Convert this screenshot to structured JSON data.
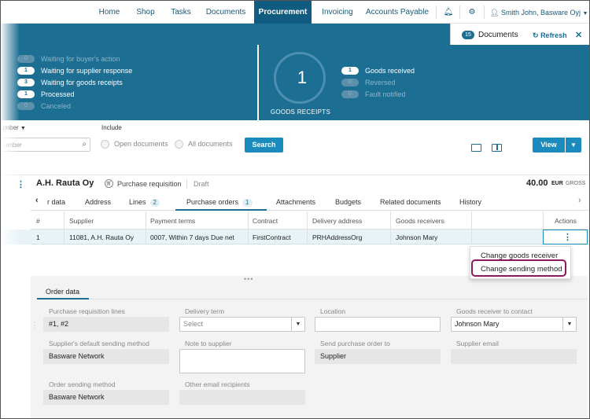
{
  "nav": {
    "items": [
      "Home",
      "Shop",
      "Tasks",
      "Documents",
      "Procurement",
      "Invoicing",
      "Accounts Payable"
    ],
    "user": "Smith John, Basware Oyj"
  },
  "doc_panel": {
    "count": "15",
    "label": "Documents",
    "refresh": "Refresh"
  },
  "dashboard_left": [
    {
      "count": "0",
      "label": "Waiting for buyer's action",
      "active": false
    },
    {
      "count": "1",
      "label": "Waiting for supplier response",
      "active": true
    },
    {
      "count": "3",
      "label": "Waiting for goods receipts",
      "active": true
    },
    {
      "count": "1",
      "label": "Processed",
      "active": true
    },
    {
      "count": "0",
      "label": "Canceled",
      "active": false
    }
  ],
  "dashboard_right": {
    "gauge_value": "1",
    "gauge_label": "GOODS RECEIPTS",
    "statuses": [
      {
        "count": "1",
        "label": "Goods received",
        "active": true
      },
      {
        "count": "0",
        "label": "Reversed",
        "active": false
      },
      {
        "count": "0",
        "label": "Fault notified",
        "active": false
      }
    ]
  },
  "search": {
    "sort_label": "umber",
    "include_label": "Include",
    "placeholder": "umber",
    "open_docs": "Open documents",
    "all_docs": "All documents",
    "search_button": "Search",
    "view_button": "View"
  },
  "document": {
    "supplier": "A.H. Rauta Oy",
    "type": "Purchase requisition",
    "status": "Draft",
    "total": "40.00",
    "currency": "EUR",
    "gross": "GROSS"
  },
  "tabs": [
    {
      "label": "r data",
      "count": ""
    },
    {
      "label": "Address",
      "count": ""
    },
    {
      "label": "Lines",
      "count": "2"
    },
    {
      "label": "Purchase orders",
      "count": "1"
    },
    {
      "label": "Attachments",
      "count": ""
    },
    {
      "label": "Budgets",
      "count": ""
    },
    {
      "label": "Related documents",
      "count": ""
    },
    {
      "label": "History",
      "count": ""
    }
  ],
  "table": {
    "headers": [
      "#",
      "Supplier",
      "Payment terms",
      "Contract",
      "Delivery address",
      "Goods receivers",
      "Actions"
    ],
    "rows": [
      [
        "1",
        "11081, A.H. Rauta Oy",
        "0007, Within 7 days Due net",
        "FirstContract",
        "PRHAddressOrg",
        "Johnson Mary"
      ]
    ]
  },
  "menu": {
    "items": [
      "Change goods receiver",
      "Change sending method"
    ]
  },
  "order_data": {
    "tab": "Order data",
    "fields": {
      "pr_lines_label": "Purchase requisition lines",
      "pr_lines_value": "#1, #2",
      "delivery_term_label": "Delivery term",
      "delivery_term_value": "Select",
      "location_label": "Location",
      "goods_receiver_contact_label": "Goods receiver to contact",
      "goods_receiver_contact_value": "Johnson Mary",
      "default_sending_label": "Supplier's default sending method",
      "default_sending_value": "Basware Network",
      "note_label": "Note to supplier",
      "send_to_label": "Send purchase order to",
      "send_to_value": "Supplier",
      "supplier_email_label": "Supplier email",
      "order_sending_label": "Order sending method",
      "order_sending_value": "Basware Network",
      "other_email_label": "Other email recipients"
    }
  }
}
